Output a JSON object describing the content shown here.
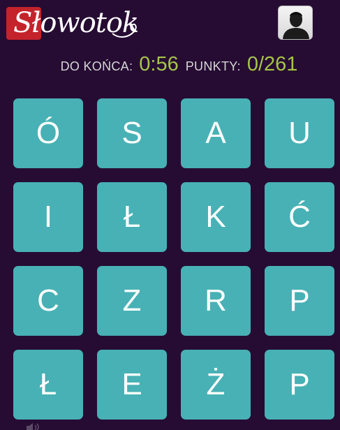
{
  "header": {
    "logo_text": "Słowotok",
    "avatar_icon": "user-silhouette-icon"
  },
  "status": {
    "time_label": "DO KOŃCA:",
    "time_value": "0:56",
    "points_label": "PUNKTY:",
    "points_value": "0/261"
  },
  "board": {
    "tiles": [
      "Ó",
      "S",
      "A",
      "U",
      "I",
      "Ł",
      "K",
      "Ć",
      "C",
      "Z",
      "R",
      "P",
      "Ł",
      "E",
      "Ż",
      "P"
    ]
  },
  "footer": {
    "sound_icon": "speaker-icon"
  },
  "colors": {
    "background": "#260c33",
    "tile": "#48b1b5",
    "logo_badge": "#c4232b",
    "value_green": "#a5c449"
  }
}
